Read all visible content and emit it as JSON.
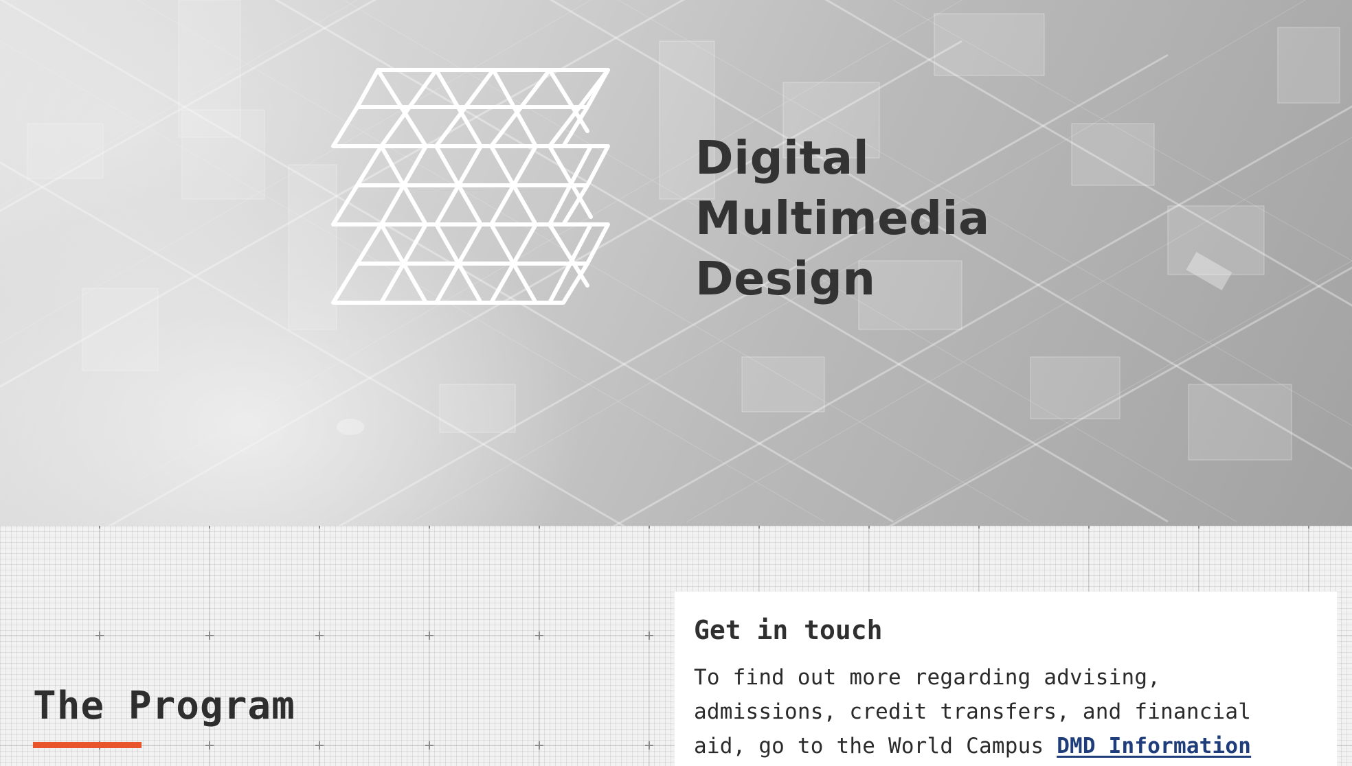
{
  "hero": {
    "title_lines": [
      "Digital",
      "Multimedia",
      "Design"
    ],
    "logo_icon": "triangle-grid-logo-icon",
    "background": "isometric-city-wireframe"
  },
  "program": {
    "heading": "The Program",
    "accent_color": "#e8542b"
  },
  "contact": {
    "heading": "Get in touch",
    "text_line1": "To find out more regarding advising,",
    "text_line2": "admissions, credit transfers, and financial",
    "text_line3": "aid, go to the World Campus ",
    "link_label": "DMD Information",
    "link_color": "#1f3d7a"
  }
}
